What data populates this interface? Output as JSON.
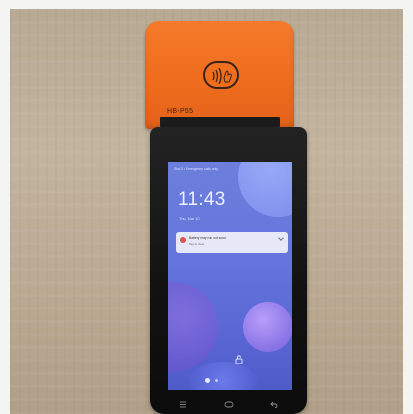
{
  "scene": {
    "printer": {
      "label": "HB-P55",
      "nfc_icon": "contactless-icon",
      "color": "#f0701f"
    },
    "screen": {
      "status_bar": "Slot-2 • Emergency calls only",
      "clock": "11:43",
      "date": "Thu, Mar 10",
      "notification": {
        "title": "Battery may run out soon",
        "body": "Tap to view"
      },
      "page_dots": 2,
      "unlock_icon": "lock-open-icon"
    },
    "nav_keys": [
      "menu-key-icon",
      "home-key-icon",
      "back-key-icon"
    ],
    "colors": {
      "wallpaper": "#6476dd",
      "body": "#141414",
      "table": "#bba992"
    }
  }
}
